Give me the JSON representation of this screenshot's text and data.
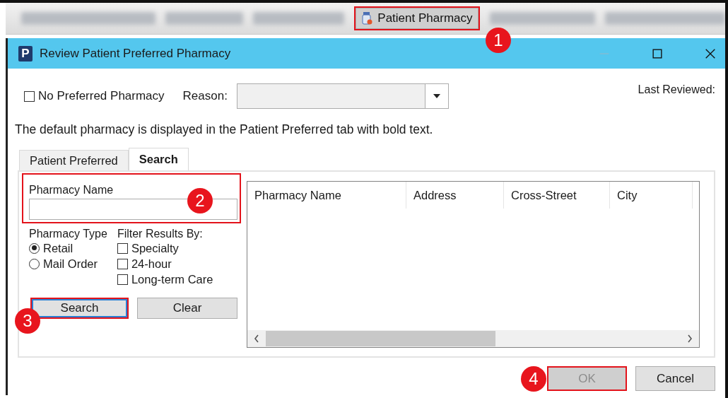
{
  "toolbar": {
    "button": {
      "label": "Patient Pharmacy",
      "highlighted": true
    }
  },
  "window": {
    "title": "Review Patient Preferred Pharmacy",
    "app_icon": "P"
  },
  "no_preferred": {
    "label": "No Preferred Pharmacy",
    "checked": false
  },
  "reason": {
    "label": "Reason:"
  },
  "last_reviewed": "Last Reviewed:",
  "notice": "The default pharmacy is displayed in the Patient Preferred tab with bold text.",
  "tabs": [
    {
      "label": "Patient Preferred",
      "selected": false
    },
    {
      "label": "Search",
      "selected": true
    }
  ],
  "search_form": {
    "name_label": "Pharmacy Name",
    "highlighted": true,
    "type_label": "Pharmacy Type",
    "types": [
      {
        "label": "Retail",
        "selected": true
      },
      {
        "label": "Mail Order",
        "selected": false
      }
    ],
    "filter_label": "Filter Results By:",
    "filters": [
      {
        "label": "Specialty",
        "checked": false
      },
      {
        "label": "24-hour",
        "checked": false
      },
      {
        "label": "Long-term Care",
        "checked": false
      }
    ],
    "search_button": {
      "label": "Search",
      "highlighted": true
    },
    "clear_button": {
      "label": "Clear"
    }
  },
  "table": {
    "columns": [
      "Pharmacy Name",
      "Address",
      "Cross-Street",
      "City"
    ]
  },
  "buttons": [
    {
      "label": "OK",
      "disabled": true,
      "highlighted": true
    },
    {
      "label": "Cancel",
      "disabled": false,
      "highlighted": false
    }
  ],
  "callouts": [
    "1",
    "2",
    "3",
    "4"
  ]
}
